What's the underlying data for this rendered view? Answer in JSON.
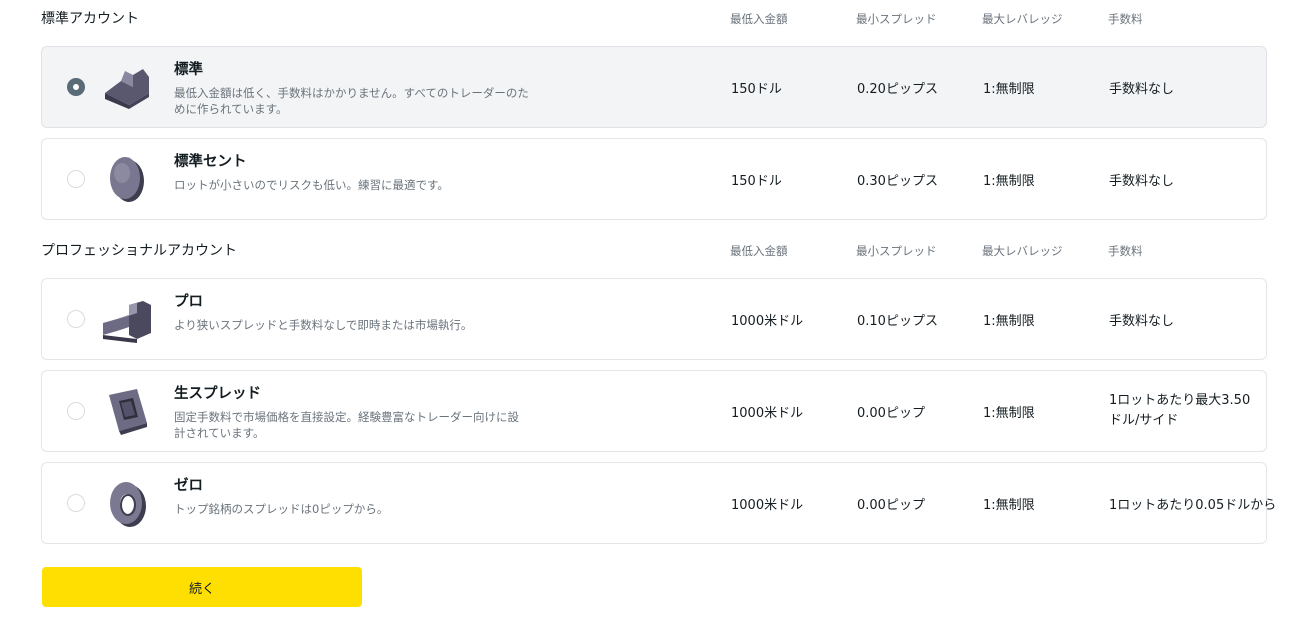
{
  "standard_section": {
    "title": "標準アカウント",
    "columns": [
      "最低入金額",
      "最小スプレッド",
      "最大レバレッジ",
      "手数料"
    ]
  },
  "professional_section": {
    "title": "プロフェッショナルアカウント",
    "columns": [
      "最低入金額",
      "最小スプレッド",
      "最大レバレッジ",
      "手数料"
    ]
  },
  "accounts": [
    {
      "name": "標準",
      "description": "最低入金額は低く、手数料はかかりません。すべてのトレーダーのために作られています。",
      "min_deposit": "150ドル",
      "min_spread": "0.20ピップス",
      "max_leverage": "1:無制限",
      "commission": "手数料なし",
      "selected": true,
      "icon": "standard-block-icon"
    },
    {
      "name": "標準セント",
      "description": "ロットが小さいのでリスクも低い。練習に最適です。",
      "min_deposit": "150ドル",
      "min_spread": "0.30ピップス",
      "max_leverage": "1:無制限",
      "commission": "手数料なし",
      "selected": false,
      "icon": "coin-icon"
    },
    {
      "name": "プロ",
      "description": "より狭いスプレッドと手数料なしで即時または市場執行。",
      "min_deposit": "1000米ドル",
      "min_spread": "0.10ピップス",
      "max_leverage": "1:無制限",
      "commission": "手数料なし",
      "selected": false,
      "icon": "stairs-icon"
    },
    {
      "name": "生スプレッド",
      "description": "固定手数料で市場価格を直接設定。経験豊富なトレーダー向けに設計されています。",
      "min_deposit": "1000米ドル",
      "min_spread": "0.00ピップ",
      "max_leverage": "1:無制限",
      "commission": "1ロットあたり最大3.50ドル/サイド",
      "selected": false,
      "icon": "frame-icon"
    },
    {
      "name": "ゼロ",
      "description": "トップ銘柄のスプレッドは0ピップから。",
      "min_deposit": "1000米ドル",
      "min_spread": "0.00ピップ",
      "max_leverage": "1:無制限",
      "commission": "1ロットあたり0.05ドルから",
      "selected": false,
      "icon": "ring-icon"
    }
  ],
  "continue_button": "続く",
  "colors": {
    "accent_yellow": "#ffde02",
    "selected_bg": "#f3f4f6",
    "radio_selected": "#5a6b78",
    "icon_dark": "#4b4a5e",
    "icon_light": "#8a88a0"
  }
}
